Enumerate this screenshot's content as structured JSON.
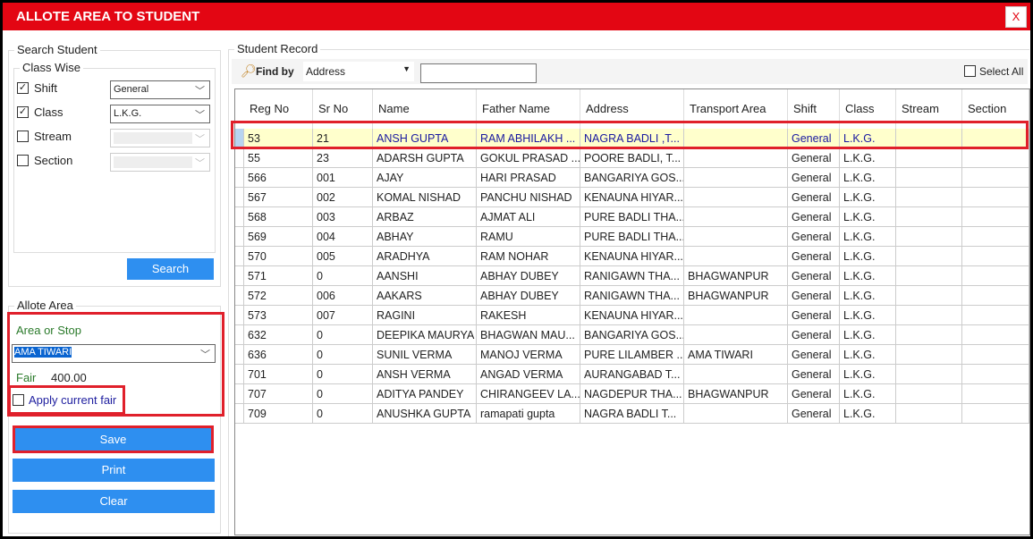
{
  "window": {
    "title": "ALLOTE AREA TO STUDENT",
    "close_label": "X"
  },
  "search": {
    "group_title": "Search Student",
    "class_wise_title": "Class Wise",
    "filters": [
      {
        "label": "Shift",
        "checked": true,
        "value": "General"
      },
      {
        "label": "Class",
        "checked": true,
        "value": "L.K.G."
      },
      {
        "label": "Stream",
        "checked": false,
        "value": ""
      },
      {
        "label": "Section",
        "checked": false,
        "value": ""
      }
    ],
    "search_button": "Search"
  },
  "allot": {
    "group_title": "Allote Area",
    "area_label": "Area or Stop",
    "area_value": "AMA TIWARI",
    "fair_label": "Fair",
    "fair_value": "400.00",
    "apply_label": "Apply current fair",
    "apply_checked": false
  },
  "actions": {
    "save": "Save",
    "print": "Print",
    "clear": "Clear"
  },
  "record": {
    "group_title": "Student Record",
    "find_by_label": "Find by",
    "find_by_value": "Address",
    "search_value": "",
    "select_all_label": "Select All",
    "columns": [
      "Reg No",
      "Sr No",
      "Name",
      "Father Name",
      "Address",
      "Transport Area",
      "Shift",
      "Class",
      "Stream",
      "Section"
    ],
    "rows": [
      [
        "53",
        "21",
        "ANSH GUPTA",
        "RAM ABHILAKH ...",
        "NAGRA BADLI ,T...",
        "",
        "General",
        "L.K.G.",
        "",
        ""
      ],
      [
        "55",
        "23",
        "ADARSH GUPTA",
        "GOKUL PRASAD ...",
        "POORE BADLI, T...",
        "",
        "General",
        "L.K.G.",
        "",
        ""
      ],
      [
        "566",
        "001",
        "AJAY",
        "HARI PRASAD",
        "BANGARIYA GOS...",
        "",
        "General",
        "L.K.G.",
        "",
        ""
      ],
      [
        "567",
        "002",
        "KOMAL NISHAD",
        "PANCHU NISHAD",
        "KENAUNA HIYAR...",
        "",
        "General",
        "L.K.G.",
        "",
        ""
      ],
      [
        "568",
        "003",
        "ARBAZ",
        "AJMAT ALI",
        "PURE BADLI THA...",
        "",
        "General",
        "L.K.G.",
        "",
        ""
      ],
      [
        "569",
        "004",
        "ABHAY",
        "RAMU",
        "PURE BADLI THA...",
        "",
        "General",
        "L.K.G.",
        "",
        ""
      ],
      [
        "570",
        "005",
        "ARADHYA",
        "RAM NOHAR",
        "KENAUNA HIYAR...",
        "",
        "General",
        "L.K.G.",
        "",
        ""
      ],
      [
        "571",
        "0",
        "AANSHI",
        "ABHAY DUBEY",
        "RANIGAWN THA...",
        "BHAGWANPUR",
        "General",
        "L.K.G.",
        "",
        ""
      ],
      [
        "572",
        "006",
        "AAKARS",
        "ABHAY DUBEY",
        "RANIGAWN THA...",
        "BHAGWANPUR",
        "General",
        "L.K.G.",
        "",
        ""
      ],
      [
        "573",
        "007",
        "RAGINI",
        "RAKESH",
        "KENAUNA HIYAR...",
        "",
        "General",
        "L.K.G.",
        "",
        ""
      ],
      [
        "632",
        "0",
        "DEEPIKA MAURYA",
        "BHAGWAN MAU...",
        "BANGARIYA GOS...",
        "",
        "General",
        "L.K.G.",
        "",
        ""
      ],
      [
        "636",
        "0",
        "SUNIL VERMA",
        " MANOJ VERMA",
        "PURE LILAMBER ...",
        "AMA TIWARI",
        "General",
        "L.K.G.",
        "",
        ""
      ],
      [
        "701",
        "0",
        "ANSH VERMA",
        "ANGAD VERMA",
        "AURANGABAD T...",
        "",
        "General",
        "L.K.G.",
        "",
        ""
      ],
      [
        "707",
        "0",
        "ADITYA PANDEY",
        "CHIRANGEEV LA...",
        "NAGDEPUR THA...",
        "BHAGWANPUR",
        "General",
        "L.K.G.",
        "",
        ""
      ],
      [
        "709",
        "0",
        "ANUSHKA GUPTA",
        "ramapati gupta",
        "NAGRA BADLI T...",
        "",
        "General",
        "L.K.G.",
        "",
        ""
      ]
    ],
    "selected_row": 0
  },
  "colors": {
    "title_bar": "#e30613",
    "button": "#2e8ff0",
    "highlight": "#e0202b",
    "selected_row": "#ffffcc",
    "selected_text": "#1a1aa0"
  }
}
